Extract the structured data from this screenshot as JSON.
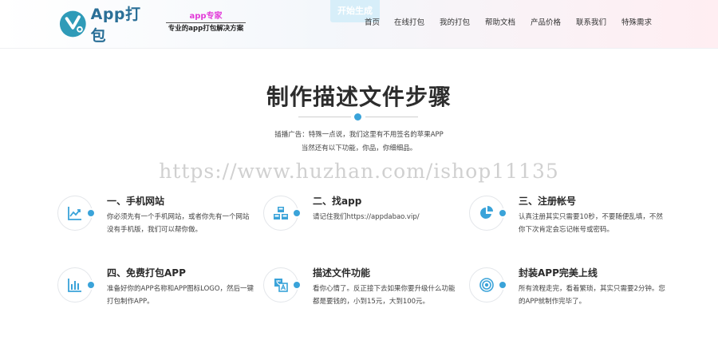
{
  "header": {
    "logo_text": "App打包",
    "tagline_top": "app专家",
    "tagline_bottom": "专业的app打包解决方案",
    "ghost_button": "开始生成",
    "nav": [
      {
        "label": "首页"
      },
      {
        "label": "在线打包"
      },
      {
        "label": "我的打包"
      },
      {
        "label": "帮助文档"
      },
      {
        "label": "产品价格"
      },
      {
        "label": "联系我们"
      },
      {
        "label": "特殊需求"
      }
    ]
  },
  "main": {
    "title": "制作描述文件步骤",
    "subtitle_line1": "插播广告：特殊一点说，我们这里有不用签名的苹果APP",
    "subtitle_line2": "当然还有以下功能，你品，你细细品。",
    "watermark": "https://www.huzhan.com/ishop11135"
  },
  "features": [
    {
      "icon": "trend-chart-icon",
      "title": "一、手机网站",
      "desc": "你必须先有一个手机网站，或者你先有一个网站没有手机版，我们可以帮你做。"
    },
    {
      "icon": "cubes-icon",
      "title": "二、找app",
      "desc": "请记住我们https://appdabao.vip/"
    },
    {
      "icon": "pie-chart-icon",
      "title": "三、注册帐号",
      "desc": "认真注册其实只需要10秒，不要随便乱填，不然你下次肯定会忘记帐号或密码。"
    },
    {
      "icon": "bar-chart-icon",
      "title": "四、免费打包APP",
      "desc": "准备好你的APP名称和APP图标LOGO，然后一键打包制作APP。"
    },
    {
      "icon": "translate-icon",
      "title": "描述文件功能",
      "desc": "看你心情了。反正接下去如果你要升级什么功能都是要钱的，小到15元，大到100元。"
    },
    {
      "icon": "target-icon",
      "title": "封装APP完美上线",
      "desc": "所有流程走完，看着繁琐，其实只需要2分钟。您的APP就制作完毕了。"
    }
  ],
  "colors": {
    "accent": "#3aa3d9",
    "logo": "#2a6f97",
    "tagline": "#e23bd8"
  }
}
